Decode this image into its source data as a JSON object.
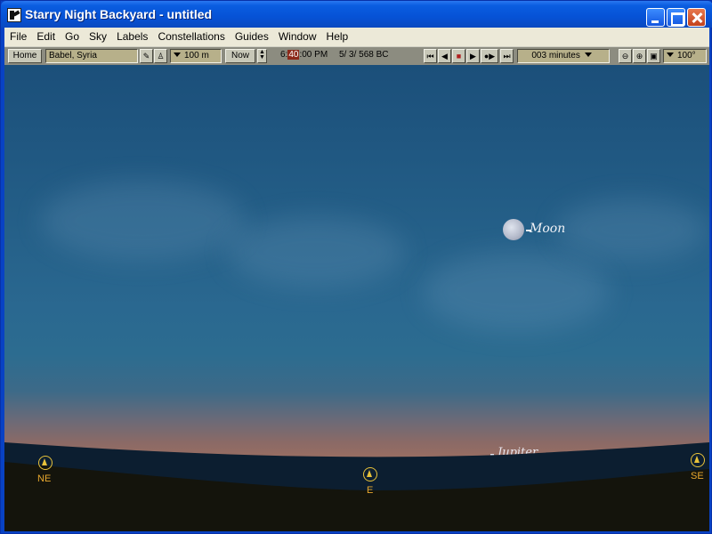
{
  "window": {
    "title": "Starry Night Backyard - untitled"
  },
  "menubar": {
    "items": [
      "File",
      "Edit",
      "Go",
      "Sky",
      "Labels",
      "Constellations",
      "Guides",
      "Window",
      "Help"
    ]
  },
  "toolbar": {
    "home_label": "Home",
    "location": "Babel, Syria",
    "elevation": "100 m",
    "now_label": "Now",
    "time_hour": "6:",
    "time_minute": "40",
    "time_rest": ":00 PM",
    "date": "5/  3/   568 BC",
    "time_step": "003 minutes",
    "zoom": "100°"
  },
  "sky": {
    "moon_label": "Moon",
    "jupiter_label": "Jupiter",
    "compass": {
      "ne": "NE",
      "e": "E",
      "se": "SE"
    }
  }
}
